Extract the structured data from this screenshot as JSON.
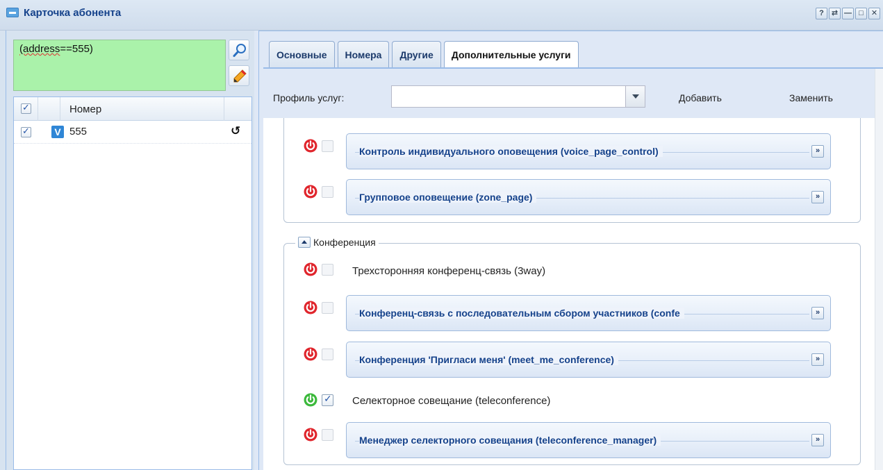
{
  "window": {
    "title": "Карточка абонента",
    "tools": [
      "?",
      "⇄",
      "—",
      "□",
      "✕"
    ]
  },
  "left": {
    "filter_text_prefix": "(address",
    "filter_text_suffix": "==555)",
    "grid": {
      "column_number": "Номер",
      "rows": [
        {
          "checked": true,
          "type_badge": "V",
          "number": "555",
          "icon": "history-icon"
        }
      ]
    }
  },
  "tabs": [
    {
      "label": "Основные",
      "active": false
    },
    {
      "label": "Номера",
      "active": false
    },
    {
      "label": "Другие",
      "active": false
    },
    {
      "label": "Дополнительные услуги",
      "active": true
    }
  ],
  "profile": {
    "label": "Профиль услуг:",
    "value": "",
    "add_label": "Добавить",
    "replace_label": "Заменить"
  },
  "groups": [
    {
      "legend": "",
      "services": [
        {
          "title": "Контроль индивидуального оповещения (voice_page_control)",
          "expandable": true,
          "enabled": false,
          "checked": false
        },
        {
          "title": "Групповое оповещение (zone_page)",
          "expandable": true,
          "enabled": false,
          "checked": false
        }
      ]
    },
    {
      "legend": "Конференция",
      "services": [
        {
          "title": "Трехсторонняя конференц-связь (3way)",
          "expandable": false,
          "enabled": false,
          "checked": false
        },
        {
          "title": "Конференц-связь с последовательным сбором участников (confe",
          "expandable": true,
          "enabled": false,
          "checked": false
        },
        {
          "title": "Конференция 'Пригласи меня' (meet_me_conference)",
          "expandable": true,
          "enabled": false,
          "checked": false
        },
        {
          "title": "Селекторное совещание (teleconference)",
          "expandable": false,
          "enabled": true,
          "checked": true
        },
        {
          "title": "Менеджер селекторного совещания (teleconference_manager)",
          "expandable": true,
          "enabled": false,
          "checked": false
        }
      ]
    }
  ],
  "colors": {
    "power_off": "#e0262d",
    "power_on": "#3cb93c",
    "title_text": "#15428b",
    "filter_bg": "#aaf2aa"
  },
  "icons": {
    "search": "search-icon",
    "edit": "pencil-icon",
    "power": "power-icon",
    "expand": "chevron-double-down-icon",
    "collapse": "chevron-up-icon"
  }
}
